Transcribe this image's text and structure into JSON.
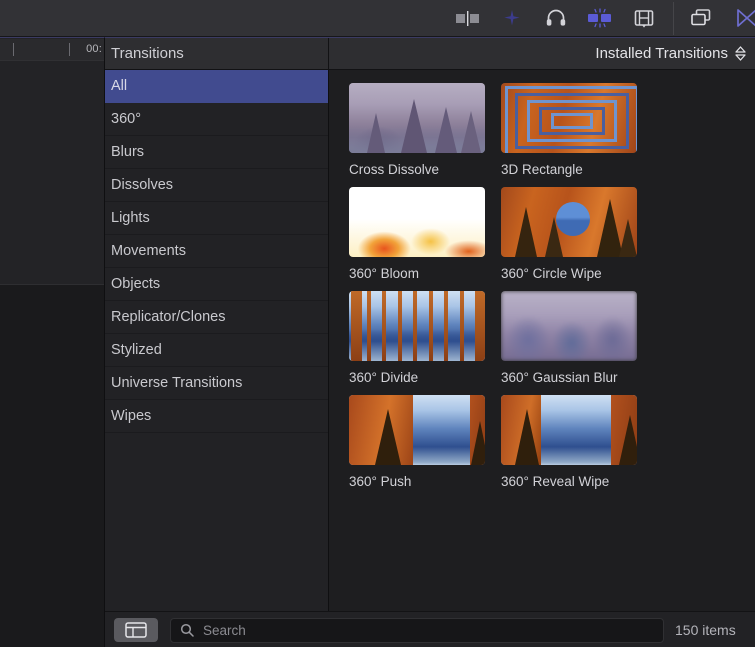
{
  "toolbar": {
    "icons": [
      {
        "name": "split-clip-icon",
        "label": "Transitions Browser"
      },
      {
        "name": "effects-plus-icon",
        "label": "Effects"
      },
      {
        "name": "headphones-icon",
        "label": "Audio"
      },
      {
        "name": "transitions-icon",
        "label": "Transitions"
      },
      {
        "name": "titles-filmstrip-icon",
        "label": "Titles and Generators"
      }
    ],
    "right_icons": [
      {
        "name": "window-layers-icon",
        "label": "Window Layout"
      },
      {
        "name": "keyframe-bowtie-icon",
        "label": "Browser Toggle"
      }
    ],
    "accent_color": "#5b5bd6"
  },
  "timeline": {
    "timecode": "00:"
  },
  "browser": {
    "header": {
      "sidebar_title": "Transitions",
      "library_label": "Installed Transitions",
      "chevron_icon": "chevron-up-down-icon"
    },
    "categories": [
      {
        "label": "All",
        "selected": true
      },
      {
        "label": "360°",
        "selected": false
      },
      {
        "label": "Blurs",
        "selected": false
      },
      {
        "label": "Dissolves",
        "selected": false
      },
      {
        "label": "Lights",
        "selected": false
      },
      {
        "label": "Movements",
        "selected": false
      },
      {
        "label": "Objects",
        "selected": false
      },
      {
        "label": "Replicator/Clones",
        "selected": false
      },
      {
        "label": "Stylized",
        "selected": false
      },
      {
        "label": "Universe Transitions",
        "selected": false
      },
      {
        "label": "Wipes",
        "selected": false
      }
    ],
    "items": [
      {
        "label": "Cross Dissolve",
        "art": "cross-dissolve"
      },
      {
        "label": "3D Rectangle",
        "art": "rectangle-3d"
      },
      {
        "label": "360° Bloom",
        "art": "bloom"
      },
      {
        "label": "360° Circle Wipe",
        "art": "circle-wipe"
      },
      {
        "label": "360° Divide",
        "art": "divide"
      },
      {
        "label": "360° Gaussian Blur",
        "art": "gaussian-blur"
      },
      {
        "label": "360° Push",
        "art": "push"
      },
      {
        "label": "360° Reveal Wipe",
        "art": "reveal-wipe"
      }
    ],
    "selected_category_color": "#414b8f"
  },
  "bottom_bar": {
    "sidebar_toggle_icon": "sidebar-panel-icon",
    "search": {
      "icon": "search-icon",
      "placeholder": "Search",
      "value": ""
    },
    "item_count": "150 items"
  }
}
